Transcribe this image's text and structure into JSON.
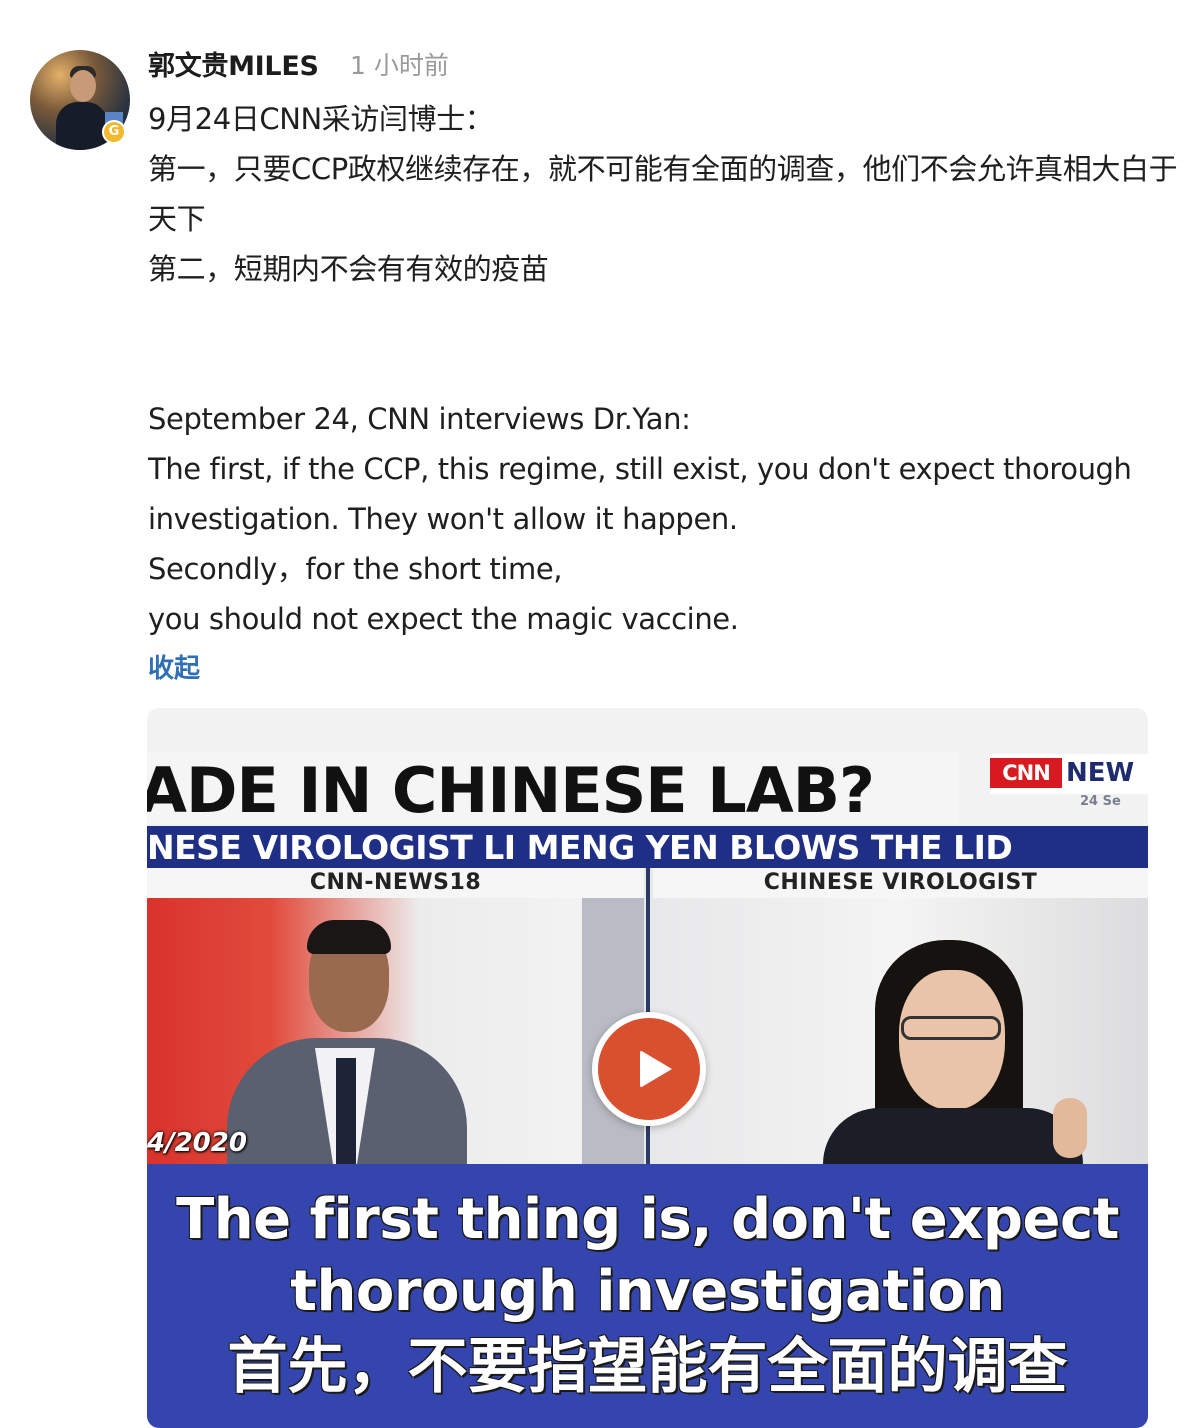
{
  "author": {
    "name": "郭文贵MILES",
    "time": "1 小时前",
    "badge": "G"
  },
  "post": {
    "lines_zh": [
      "9月24日CNN采访闫博士：",
      "第一，只要CCP政权继续存在，就不可能有全面的调查，他们不会允许真相大白于天下",
      "第二，短期内不会有有效的疫苗"
    ],
    "lines_en": [
      "September 24, CNN interviews Dr.Yan:",
      "The first, if the CCP, this regime, still exist, you don't expect thorough",
      "investigation. They won't allow it happen.",
      "Secondly，for the short time,",
      "you should not expect the magic vaccine."
    ],
    "collapse_label": "收起"
  },
  "video": {
    "headline": "ADE IN CHINESE LAB?",
    "ticker": "NESE VIROLOGIST LI MENG YEN BLOWS THE LID",
    "logo_cnn": "CNN",
    "logo_news": "NEW",
    "logo_date": "24 Se",
    "left_label": "CNN-NEWS18",
    "right_label": "CHINESE VIROLOGIST",
    "date_stamp": "4/2020",
    "subtitle_en_1": "The first thing is, don't expect",
    "subtitle_en_2": "thorough investigation",
    "subtitle_zh": "首先，不要指望能有全面的调查",
    "play_icon": "play-icon"
  }
}
